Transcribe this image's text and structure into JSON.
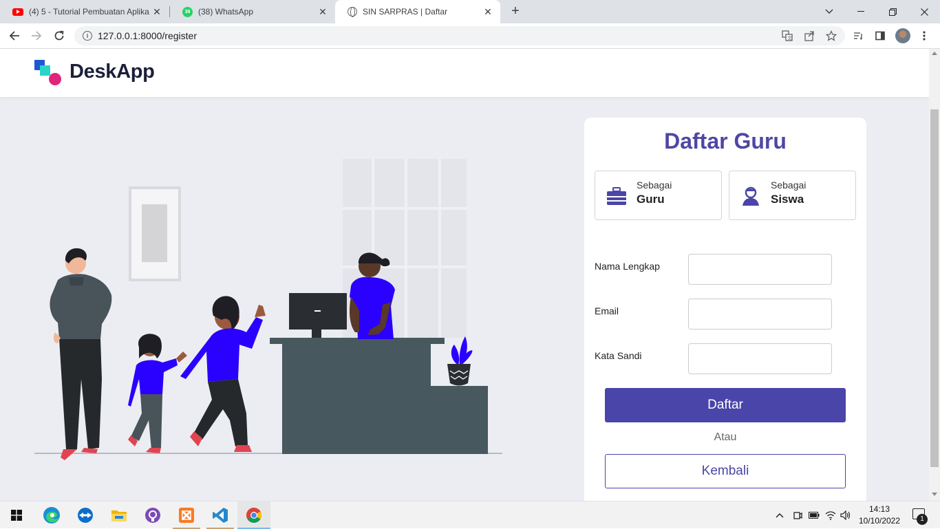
{
  "browser": {
    "tabs": [
      {
        "title": "(4) 5 - Tutorial Pembuatan Aplika",
        "favicon": "youtube-icon"
      },
      {
        "title": "(38) WhatsApp",
        "favicon": "whatsapp-icon",
        "badge": "38"
      },
      {
        "title": "SIN SARPRAS | Daftar",
        "favicon": "globe-icon"
      }
    ],
    "url": "127.0.0.1:8000/register"
  },
  "header": {
    "brand": "DeskApp",
    "colors": {
      "blue": "#1e57d6",
      "teal": "#2bd4c5",
      "pink": "#e0247a"
    }
  },
  "form": {
    "title": "Daftar Guru",
    "roles": [
      {
        "small": "Sebagai",
        "big": "Guru",
        "icon": "briefcase-icon"
      },
      {
        "small": "Sebagai",
        "big": "Siswa",
        "icon": "student-icon"
      }
    ],
    "fields": [
      {
        "label": "Nama Lengkap",
        "value": ""
      },
      {
        "label": "Email",
        "value": ""
      },
      {
        "label": "Kata Sandi",
        "value": ""
      }
    ],
    "submit_label": "Daftar",
    "or_label": "Atau",
    "back_label": "Kembali",
    "accent": "#4a45a8"
  },
  "taskbar": {
    "apps": [
      "windows-start-icon",
      "edge-icon",
      "teamviewer-icon",
      "file-explorer-icon",
      "github-icon",
      "xampp-icon",
      "vscode-icon",
      "chrome-icon"
    ],
    "time": "14:13",
    "date": "10/10/2022",
    "notification_count": "1"
  }
}
